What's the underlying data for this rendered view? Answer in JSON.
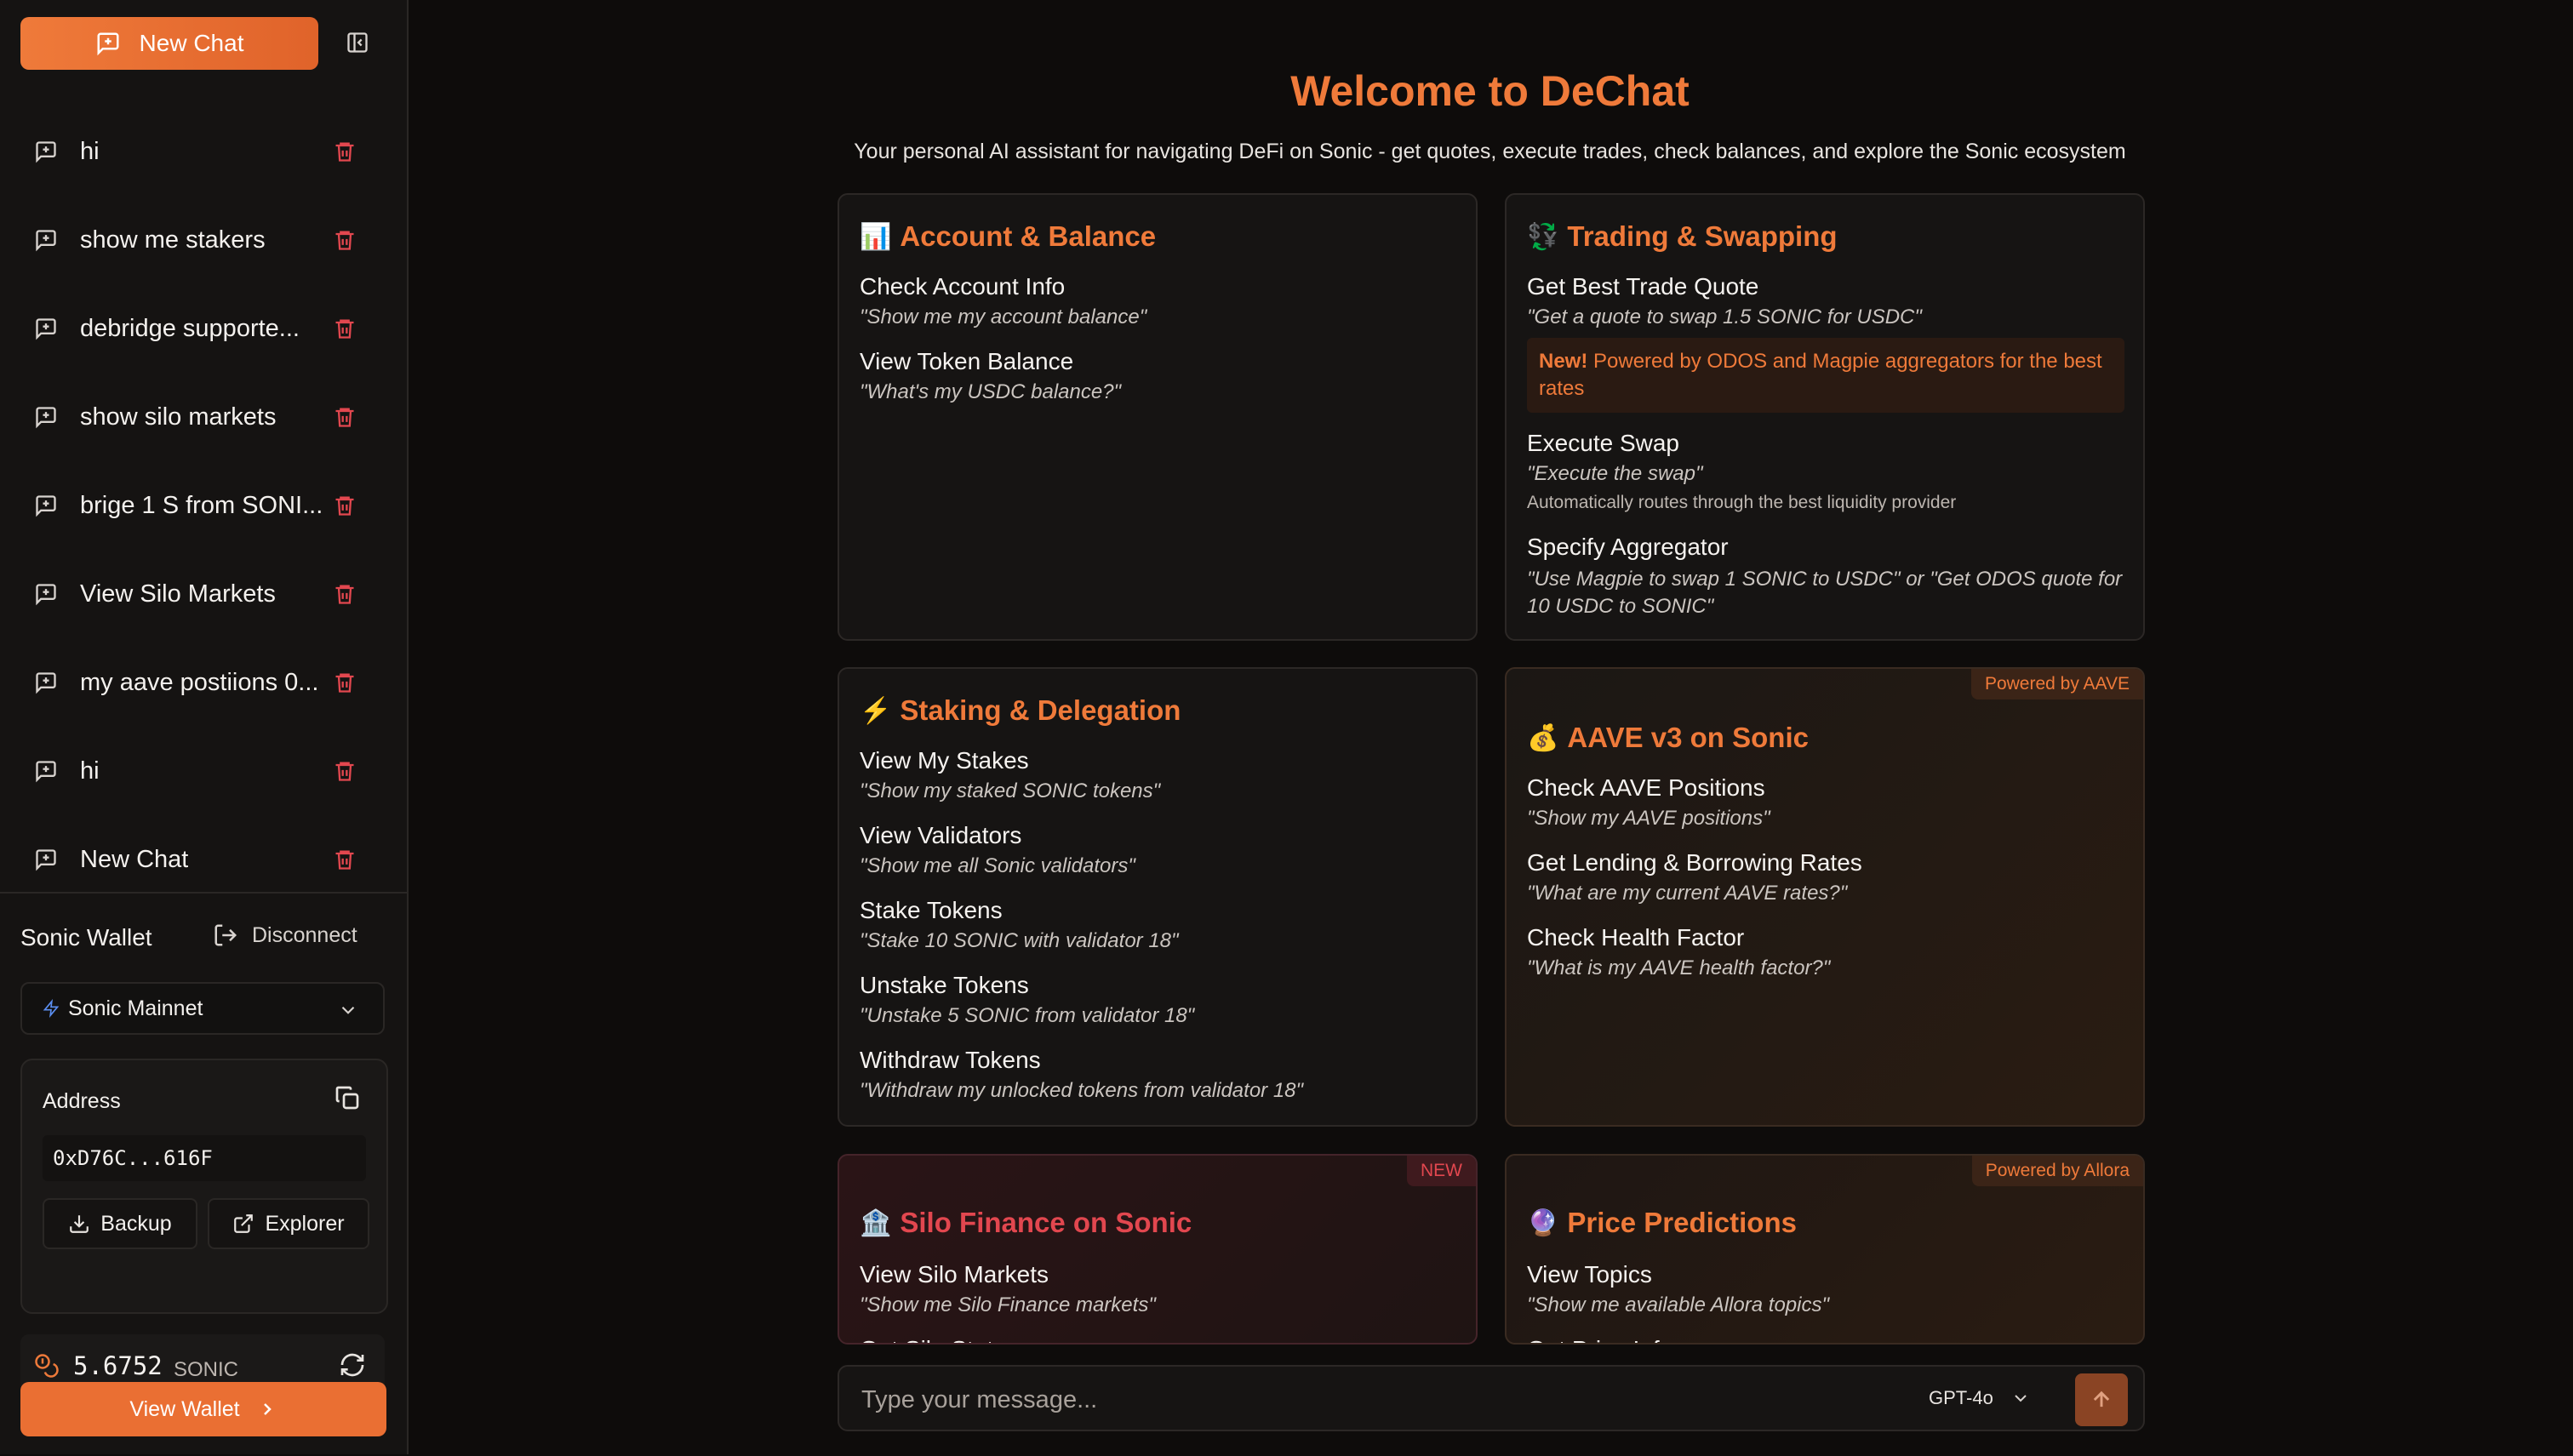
{
  "sidebar": {
    "new_chat_label": "New Chat",
    "chats": [
      {
        "label": "hi"
      },
      {
        "label": "show me stakers"
      },
      {
        "label": "debridge supporte..."
      },
      {
        "label": "show silo markets"
      },
      {
        "label": "brige 1 S from SONI..."
      },
      {
        "label": "View Silo Markets"
      },
      {
        "label": "my aave postiions 0..."
      },
      {
        "label": "hi"
      },
      {
        "label": "New Chat"
      }
    ]
  },
  "wallet": {
    "title": "Sonic Wallet",
    "disconnect_label": "Disconnect",
    "network": "Sonic Mainnet",
    "address_label": "Address",
    "address": "0xD76C...616F",
    "backup_label": "Backup",
    "explorer_label": "Explorer",
    "balance": "5.6752",
    "balance_unit": "SONIC",
    "view_wallet_label": "View Wallet"
  },
  "main": {
    "title": "Welcome to DeChat",
    "subtitle": "Your personal AI assistant for navigating DeFi on Sonic - get quotes, execute trades, check balances, and explore the Sonic ecosystem",
    "cards": {
      "account": {
        "emoji": "📊",
        "title": "Account & Balance",
        "items": [
          {
            "title": "Check Account Info",
            "example": "\"Show me my account balance\""
          },
          {
            "title": "View Token Balance",
            "example": "\"What's my USDC balance?\""
          }
        ]
      },
      "trading": {
        "emoji": "💱",
        "title": "Trading & Swapping",
        "items": [
          {
            "title": "Get Best Trade Quote",
            "example": "\"Get a quote to swap 1.5 SONIC for USDC\""
          },
          {
            "title": "Execute Swap",
            "example": "\"Execute the swap\"",
            "note": "Automatically routes through the best liquidity provider"
          },
          {
            "title": "Specify Aggregator",
            "example": "\"Use Magpie to swap 1 SONIC to USDC\" or \"Get ODOS quote for 10 USDC to SONIC\""
          }
        ],
        "new_prefix": "New!",
        "new_text": " Powered by ODOS and Magpie aggregators for the best rates"
      },
      "staking": {
        "emoji": "⚡",
        "title": "Staking & Delegation",
        "items": [
          {
            "title": "View My Stakes",
            "example": "\"Show my staked SONIC tokens\""
          },
          {
            "title": "View Validators",
            "example": "\"Show me all Sonic validators\""
          },
          {
            "title": "Stake Tokens",
            "example": "\"Stake 10 SONIC with validator 18\""
          },
          {
            "title": "Unstake Tokens",
            "example": "\"Unstake 5 SONIC from validator 18\""
          },
          {
            "title": "Withdraw Tokens",
            "example": "\"Withdraw my unlocked tokens from validator 18\""
          }
        ]
      },
      "aave": {
        "emoji": "💰",
        "title": "AAVE v3 on Sonic",
        "badge": "Powered by AAVE",
        "items": [
          {
            "title": "Check AAVE Positions",
            "example": "\"Show my AAVE positions\""
          },
          {
            "title": "Get Lending & Borrowing Rates",
            "example": "\"What are my current AAVE rates?\""
          },
          {
            "title": "Check Health Factor",
            "example": "\"What is my AAVE health factor?\""
          }
        ]
      },
      "silo": {
        "emoji": "🏦",
        "title": "Silo Finance on Sonic",
        "badge": "NEW",
        "items": [
          {
            "title": "View Silo Markets",
            "example": "\"Show me Silo Finance markets\""
          },
          {
            "title": "Get Silo Stats"
          }
        ]
      },
      "allora": {
        "emoji": "🔮",
        "title": "Price Predictions",
        "badge": "Powered by Allora",
        "items": [
          {
            "title": "View Topics",
            "example": "\"Show me available Allora topics\""
          },
          {
            "title": "Get Price Info"
          }
        ]
      }
    }
  },
  "composer": {
    "placeholder": "Type your message...",
    "model": "GPT-4o"
  },
  "colors": {
    "accent": "#ef7a3a",
    "background": "#0e0c0b",
    "delete": "#e2474f"
  }
}
